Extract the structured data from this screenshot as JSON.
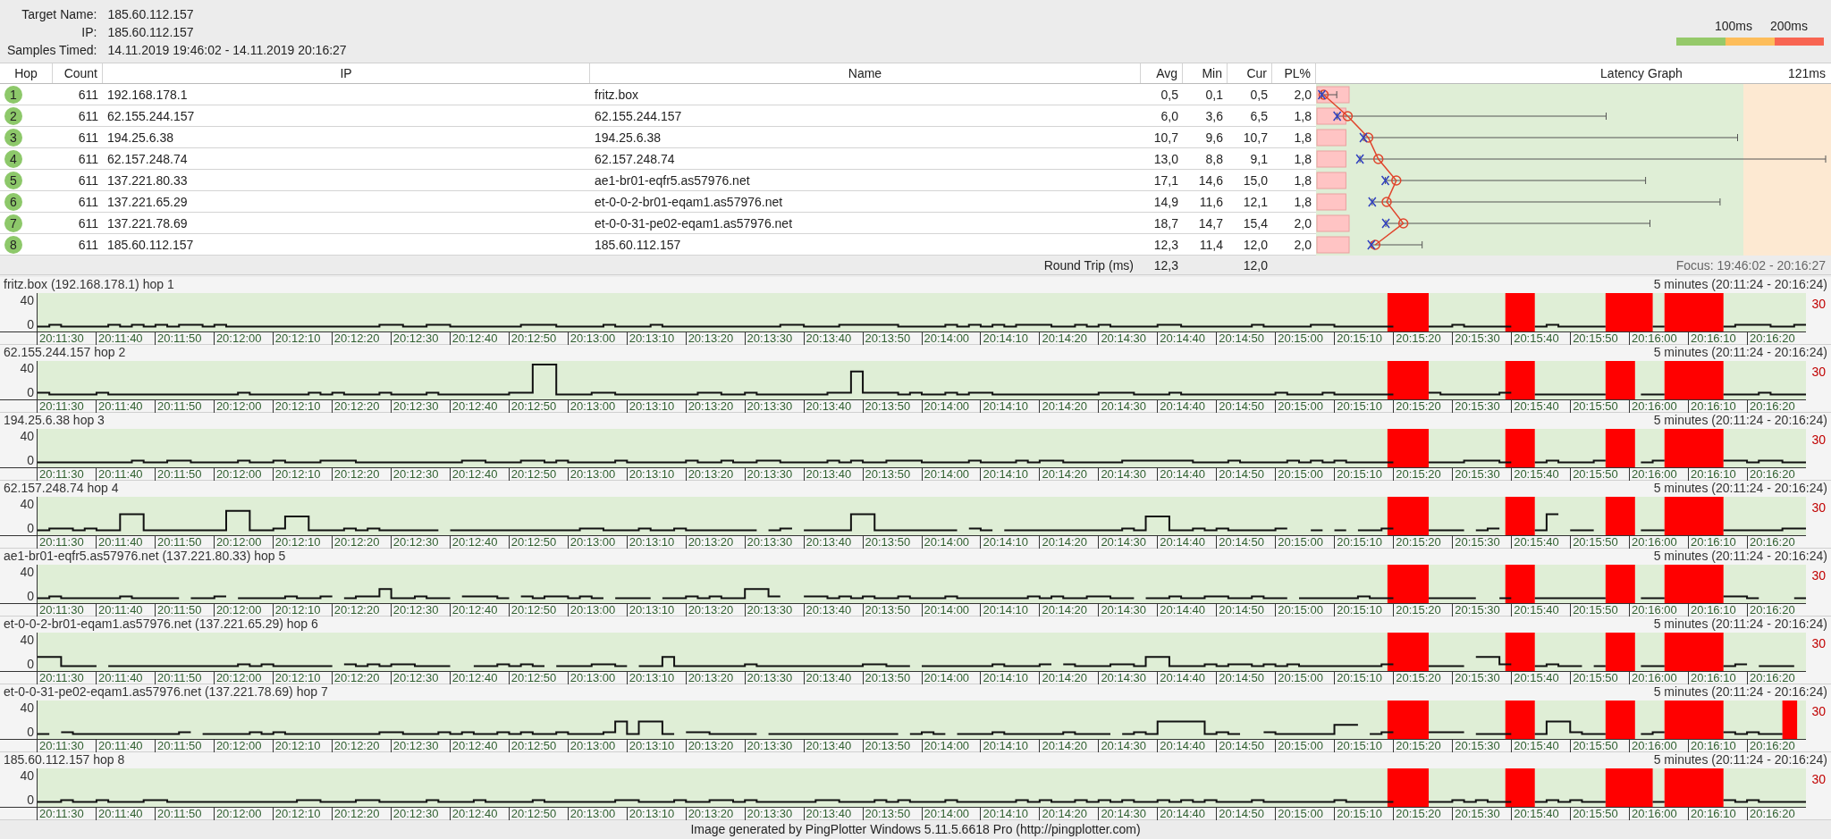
{
  "header": {
    "fields": [
      {
        "label": "Target Name:",
        "value": "185.60.112.157"
      },
      {
        "label": "IP:",
        "value": "185.60.112.157"
      },
      {
        "label": "Samples Timed:",
        "value": "14.11.2019 19:46:02 - 14.11.2019 20:16:27"
      }
    ],
    "legend": [
      "100ms",
      "200ms"
    ]
  },
  "table": {
    "columns": [
      "Hop",
      "Count",
      "IP",
      "Name",
      "Avg",
      "Min",
      "Cur",
      "PL%",
      "Latency Graph"
    ],
    "scale_label": "121ms",
    "rows": [
      {
        "hop": "1",
        "count": "611",
        "ip": "192.168.178.1",
        "name": "fritz.box",
        "avg": "0,5",
        "min": "0,1",
        "cur": "0,5",
        "pl": "2,0"
      },
      {
        "hop": "2",
        "count": "611",
        "ip": "62.155.244.157",
        "name": "62.155.244.157",
        "avg": "6,0",
        "min": "3,6",
        "cur": "6,5",
        "pl": "1,8"
      },
      {
        "hop": "3",
        "count": "611",
        "ip": "194.25.6.38",
        "name": "194.25.6.38",
        "avg": "10,7",
        "min": "9,6",
        "cur": "10,7",
        "pl": "1,8"
      },
      {
        "hop": "4",
        "count": "611",
        "ip": "62.157.248.74",
        "name": "62.157.248.74",
        "avg": "13,0",
        "min": "8,8",
        "cur": "9,1",
        "pl": "1,8"
      },
      {
        "hop": "5",
        "count": "611",
        "ip": "137.221.80.33",
        "name": "ae1-br01-eqfr5.as57976.net",
        "avg": "17,1",
        "min": "14,6",
        "cur": "15,0",
        "pl": "1,8"
      },
      {
        "hop": "6",
        "count": "611",
        "ip": "137.221.65.29",
        "name": "et-0-0-2-br01-eqam1.as57976.net",
        "avg": "14,9",
        "min": "11,6",
        "cur": "12,1",
        "pl": "1,8"
      },
      {
        "hop": "7",
        "count": "611",
        "ip": "137.221.78.69",
        "name": "et-0-0-31-pe02-eqam1.as57976.net",
        "avg": "18,7",
        "min": "14,7",
        "cur": "15,4",
        "pl": "2,0"
      },
      {
        "hop": "8",
        "count": "611",
        "ip": "185.60.112.157",
        "name": "185.60.112.157",
        "avg": "12,3",
        "min": "11,4",
        "cur": "12,0",
        "pl": "2,0"
      }
    ],
    "summary": {
      "label": "Round Trip (ms)",
      "avg": "12,3",
      "cur": "12,0",
      "focus": "Focus: 19:46:02 - 20:16:27"
    }
  },
  "graphs": [
    {
      "title": "fritz.box (192.168.178.1) hop 1",
      "range": "5 minutes (20:11:24 - 20:16:24)",
      "y_ticks": [
        "40",
        "0"
      ],
      "right_label": "30",
      "x_ticks": [
        "20:11:30",
        "20:11:40",
        "20:11:50",
        "20:12:00",
        "20:12:10",
        "20:12:20",
        "20:12:30",
        "20:12:40",
        "20:12:50",
        "20:13:00",
        "20:13:10",
        "20:13:20",
        "20:13:30",
        "20:13:40",
        "20:13:50",
        "20:14:00",
        "20:14:10",
        "20:14:20",
        "20:14:30",
        "20:14:40",
        "20:14:50",
        "20:15:00",
        "20:15:10",
        "20:15:20",
        "20:15:30",
        "20:15:40",
        "20:15:50",
        "20:16:00",
        "20:16:10",
        "20:16:20"
      ]
    },
    {
      "title": "62.155.244.157 hop 2",
      "range": "5 minutes (20:11:24 - 20:16:24)",
      "y_ticks": [
        "40",
        "0"
      ],
      "right_label": "30",
      "x_ticks": [
        "20:11:30",
        "20:11:40",
        "20:11:50",
        "20:12:00",
        "20:12:10",
        "20:12:20",
        "20:12:30",
        "20:12:40",
        "20:12:50",
        "20:13:00",
        "20:13:10",
        "20:13:20",
        "20:13:30",
        "20:13:40",
        "20:13:50",
        "20:14:00",
        "20:14:10",
        "20:14:20",
        "20:14:30",
        "20:14:40",
        "20:14:50",
        "20:15:00",
        "20:15:10",
        "20:15:20",
        "20:15:30",
        "20:15:40",
        "20:15:50",
        "20:16:00",
        "20:16:10",
        "20:16:20"
      ]
    },
    {
      "title": "194.25.6.38 hop 3",
      "range": "5 minutes (20:11:24 - 20:16:24)",
      "y_ticks": [
        "40",
        "0"
      ],
      "right_label": "30",
      "x_ticks": [
        "20:11:30",
        "20:11:40",
        "20:11:50",
        "20:12:00",
        "20:12:10",
        "20:12:20",
        "20:12:30",
        "20:12:40",
        "20:12:50",
        "20:13:00",
        "20:13:10",
        "20:13:20",
        "20:13:30",
        "20:13:40",
        "20:13:50",
        "20:14:00",
        "20:14:10",
        "20:14:20",
        "20:14:30",
        "20:14:40",
        "20:14:50",
        "20:15:00",
        "20:15:10",
        "20:15:20",
        "20:15:30",
        "20:15:40",
        "20:15:50",
        "20:16:00",
        "20:16:10",
        "20:16:20"
      ]
    },
    {
      "title": "62.157.248.74 hop 4",
      "range": "5 minutes (20:11:24 - 20:16:24)",
      "y_ticks": [
        "40",
        "0"
      ],
      "right_label": "30",
      "x_ticks": [
        "20:11:30",
        "20:11:40",
        "20:11:50",
        "20:12:00",
        "20:12:10",
        "20:12:20",
        "20:12:30",
        "20:12:40",
        "20:12:50",
        "20:13:00",
        "20:13:10",
        "20:13:20",
        "20:13:30",
        "20:13:40",
        "20:13:50",
        "20:14:00",
        "20:14:10",
        "20:14:20",
        "20:14:30",
        "20:14:40",
        "20:14:50",
        "20:15:00",
        "20:15:10",
        "20:15:20",
        "20:15:30",
        "20:15:40",
        "20:15:50",
        "20:16:00",
        "20:16:10",
        "20:16:20"
      ]
    },
    {
      "title": "ae1-br01-eqfr5.as57976.net (137.221.80.33) hop 5",
      "range": "5 minutes (20:11:24 - 20:16:24)",
      "y_ticks": [
        "40",
        "0"
      ],
      "right_label": "30",
      "x_ticks": [
        "20:11:30",
        "20:11:40",
        "20:11:50",
        "20:12:00",
        "20:12:10",
        "20:12:20",
        "20:12:30",
        "20:12:40",
        "20:12:50",
        "20:13:00",
        "20:13:10",
        "20:13:20",
        "20:13:30",
        "20:13:40",
        "20:13:50",
        "20:14:00",
        "20:14:10",
        "20:14:20",
        "20:14:30",
        "20:14:40",
        "20:14:50",
        "20:15:00",
        "20:15:10",
        "20:15:20",
        "20:15:30",
        "20:15:40",
        "20:15:50",
        "20:16:00",
        "20:16:10",
        "20:16:20"
      ]
    },
    {
      "title": "et-0-0-2-br01-eqam1.as57976.net (137.221.65.29) hop 6",
      "range": "5 minutes (20:11:24 - 20:16:24)",
      "y_ticks": [
        "40",
        "0"
      ],
      "right_label": "30",
      "x_ticks": [
        "20:11:30",
        "20:11:40",
        "20:11:50",
        "20:12:00",
        "20:12:10",
        "20:12:20",
        "20:12:30",
        "20:12:40",
        "20:12:50",
        "20:13:00",
        "20:13:10",
        "20:13:20",
        "20:13:30",
        "20:13:40",
        "20:13:50",
        "20:14:00",
        "20:14:10",
        "20:14:20",
        "20:14:30",
        "20:14:40",
        "20:14:50",
        "20:15:00",
        "20:15:10",
        "20:15:20",
        "20:15:30",
        "20:15:40",
        "20:15:50",
        "20:16:00",
        "20:16:10",
        "20:16:20"
      ]
    },
    {
      "title": "et-0-0-31-pe02-eqam1.as57976.net (137.221.78.69) hop 7",
      "range": "5 minutes (20:11:24 - 20:16:24)",
      "y_ticks": [
        "40",
        "0"
      ],
      "right_label": "30",
      "x_ticks": [
        "20:11:30",
        "20:11:40",
        "20:11:50",
        "20:12:00",
        "20:12:10",
        "20:12:20",
        "20:12:30",
        "20:12:40",
        "20:12:50",
        "20:13:00",
        "20:13:10",
        "20:13:20",
        "20:13:30",
        "20:13:40",
        "20:13:50",
        "20:14:00",
        "20:14:10",
        "20:14:20",
        "20:14:30",
        "20:14:40",
        "20:14:50",
        "20:15:00",
        "20:15:10",
        "20:15:20",
        "20:15:30",
        "20:15:40",
        "20:15:50",
        "20:16:00",
        "20:16:10",
        "20:16:20"
      ]
    },
    {
      "title": "185.60.112.157 hop 8",
      "range": "5 minutes (20:11:24 - 20:16:24)",
      "y_ticks": [
        "40",
        "0"
      ],
      "right_label": "30",
      "x_ticks": [
        "20:11:30",
        "20:11:40",
        "20:11:50",
        "20:12:00",
        "20:12:10",
        "20:12:20",
        "20:12:30",
        "20:12:40",
        "20:12:50",
        "20:13:00",
        "20:13:10",
        "20:13:20",
        "20:13:30",
        "20:13:40",
        "20:13:50",
        "20:14:00",
        "20:14:10",
        "20:14:20",
        "20:14:30",
        "20:14:40",
        "20:14:50",
        "20:15:00",
        "20:15:10",
        "20:15:20",
        "20:15:30",
        "20:15:40",
        "20:15:50",
        "20:16:00",
        "20:16:10",
        "20:16:20"
      ]
    }
  ],
  "footer": "Image generated by PingPlotter Windows 5.11.5.6618 Pro (http://pingplotter.com)"
}
